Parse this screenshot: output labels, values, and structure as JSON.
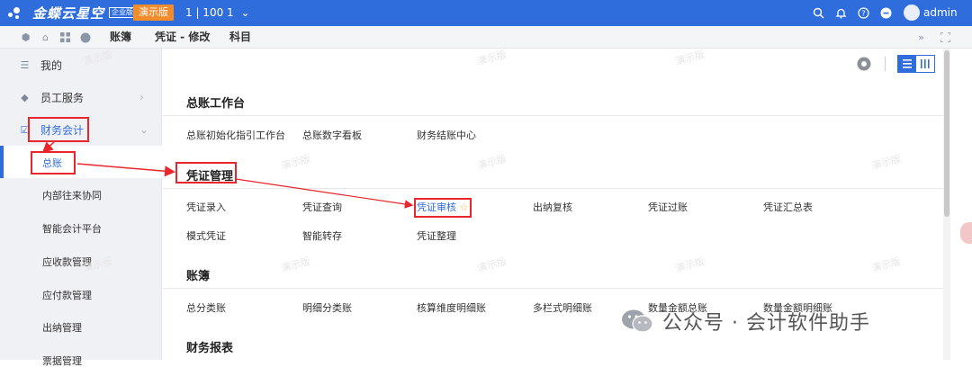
{
  "header": {
    "logo_text": "金蝶云星空",
    "edition_badge": "企业版",
    "demo_badge": "演示版",
    "org": "1 | 100 1",
    "user": "admin"
  },
  "nav": {
    "crumbs": [
      "账簿",
      "凭证 - 修改",
      "科目"
    ]
  },
  "sidebar": {
    "items": [
      {
        "label": "我的"
      },
      {
        "label": "员工服务"
      },
      {
        "label": "财务会计"
      }
    ],
    "sub_items": [
      {
        "label": "总账"
      },
      {
        "label": "内部往来协同"
      },
      {
        "label": "智能会计平台"
      },
      {
        "label": "应收款管理"
      },
      {
        "label": "应付款管理"
      },
      {
        "label": "出纳管理"
      },
      {
        "label": "票据管理"
      }
    ]
  },
  "main": {
    "sections": [
      {
        "title": "总账工作台",
        "links": [
          "总账初始化指引工作台",
          "总账数字看板",
          "财务结账中心"
        ]
      },
      {
        "title": "凭证管理",
        "links": [
          "凭证录入",
          "凭证查询",
          "凭证审核",
          "出纳复核",
          "凭证过账",
          "凭证汇总表",
          "模式凭证",
          "智能转存",
          "凭证整理"
        ]
      },
      {
        "title": "账簿",
        "links": [
          "总分类账",
          "明细分类账",
          "核算维度明细账",
          "多栏式明细账",
          "数量金额总账",
          "数量金额明细账"
        ]
      },
      {
        "title": "财务报表",
        "links": []
      }
    ],
    "watermark": "演示版"
  },
  "overlay": {
    "wechat_text": "公众号 · 会计软件助手"
  },
  "colors": {
    "brand": "#2f6ddc",
    "demo": "#f28c2b",
    "annotation": "#e8262b"
  }
}
